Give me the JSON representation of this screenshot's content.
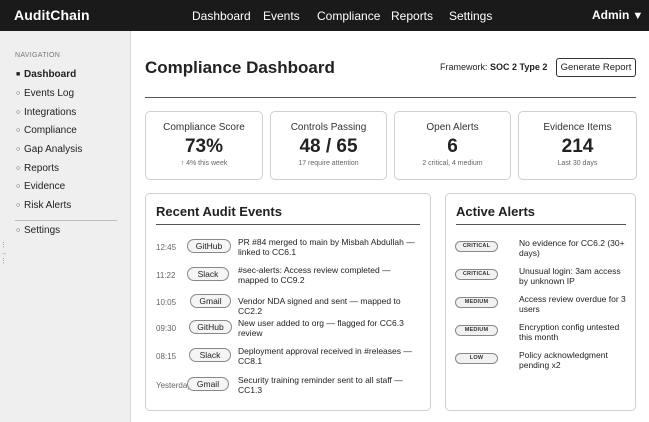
{
  "app": {
    "brand": "AuditChain",
    "nav": [
      "Dashboard",
      "Events",
      "Compliance",
      "Reports",
      "Settings"
    ],
    "user_menu": "Admin",
    "user_caret": "▼"
  },
  "sidebar": {
    "heading": "NAVIGATION",
    "items": [
      {
        "label": "Dashboard",
        "marker": "■",
        "active": true
      },
      {
        "label": "Events Log",
        "marker": "○"
      },
      {
        "label": "Integrations",
        "marker": "○"
      },
      {
        "label": "Compliance",
        "marker": "○"
      },
      {
        "label": "Gap Analysis",
        "marker": "○"
      },
      {
        "label": "Reports",
        "marker": "○"
      },
      {
        "label": "Evidence",
        "marker": "○"
      },
      {
        "label": "Risk Alerts",
        "marker": "○"
      }
    ],
    "settings": {
      "label": "Settings",
      "marker": "○"
    }
  },
  "page": {
    "title": "Compliance Dashboard",
    "framework_label": "Framework:",
    "framework_value": "SOC 2 Type 2",
    "generate_report": "Generate Report"
  },
  "stats": [
    {
      "label": "Compliance Score",
      "value": "73%",
      "sub": "↑ 4% this week"
    },
    {
      "label": "Controls Passing",
      "value": "48 / 65",
      "sub": "17 require attention"
    },
    {
      "label": "Open Alerts",
      "value": "6",
      "sub": "2 critical, 4 medium"
    },
    {
      "label": "Evidence Items",
      "value": "214",
      "sub": "Last 30 days"
    }
  ],
  "events": {
    "title": "Recent Audit Events",
    "rows": [
      {
        "time": "12:45",
        "source": "GitHub",
        "text": "PR #84 merged to main by Misbah Abdullah — linked to CC6.1"
      },
      {
        "time": "11:22",
        "source": "Slack",
        "text": "#sec-alerts: Access review completed — mapped to CC9.2"
      },
      {
        "time": "10:05",
        "source": "Gmail",
        "text": "Vendor NDA signed and sent — mapped to CC2.2"
      },
      {
        "time": "09:30",
        "source": "GitHub",
        "text": "New user added to org — flagged for CC6.3 review"
      },
      {
        "time": "08:15",
        "source": "Slack",
        "text": "Deployment approval received in #releases — CC8.1"
      },
      {
        "time": "Yesterday",
        "source": "Gmail",
        "text": "Security training reminder sent to all staff — CC1.3"
      }
    ]
  },
  "alerts": {
    "title": "Active Alerts",
    "rows": [
      {
        "severity": "CRITICAL",
        "text": "No evidence for CC6.2 (30+ days)"
      },
      {
        "severity": "CRITICAL",
        "text": "Unusual login: 3am access by unknown IP"
      },
      {
        "severity": "MEDIUM",
        "text": "Access review overdue for 3 users"
      },
      {
        "severity": "MEDIUM",
        "text": "Encryption config untested this month"
      },
      {
        "severity": "LOW",
        "text": "Policy acknowledgment pending x2"
      }
    ]
  }
}
